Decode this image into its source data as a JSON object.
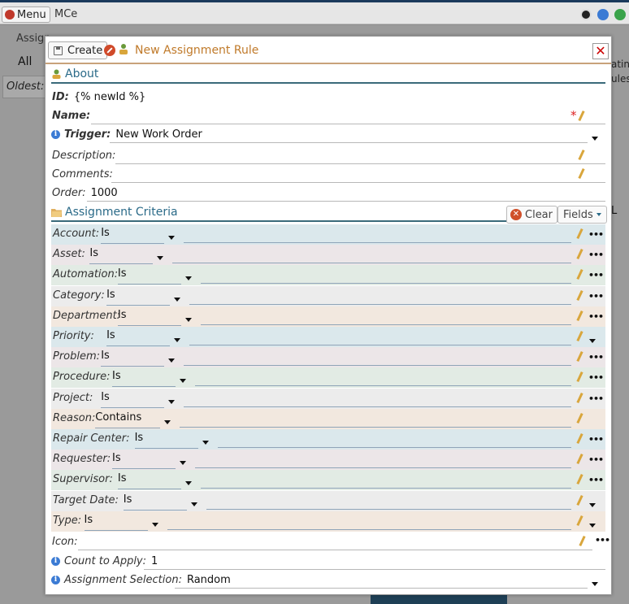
{
  "app": {
    "menu_label": "Menu",
    "title": "MCe"
  },
  "background": {
    "tab_label": "Assign",
    "filter_all": "All",
    "oldest_label": "Oldest:",
    "right_text_1": "ating",
    "right_text_2": "ules",
    "right_letter": "L"
  },
  "dialog": {
    "create_label": "Create",
    "title": "New Assignment Rule",
    "close_label": "✕",
    "about": {
      "heading": "About",
      "id_label": "ID:",
      "id_value": "{% newId %}",
      "name_label": "Name:",
      "name_value": "",
      "required_mark": "*",
      "trigger_label": "Trigger:",
      "trigger_value": "New Work Order",
      "description_label": "Description:",
      "comments_label": "Comments:",
      "order_label": "Order:",
      "order_value": "1000"
    },
    "criteria": {
      "heading": "Assignment Criteria",
      "clear_label": "Clear",
      "fields_label": "Fields",
      "rows": [
        {
          "label": "Account:",
          "operator": "Is",
          "bg": "#dbe8ec"
        },
        {
          "label": "Asset:",
          "operator": "Is",
          "bg": "#ece6e8"
        },
        {
          "label": "Automation:",
          "operator": "Is",
          "bg": "#e2ebe4"
        },
        {
          "label": "Category:",
          "operator": "Is",
          "bg": "#ececec"
        },
        {
          "label": "Department:",
          "operator": "Is",
          "bg": "#f2e8df"
        },
        {
          "label": "Priority:",
          "operator": "Is",
          "bg": "#dbe8ec"
        },
        {
          "label": "Problem:",
          "operator": "Is",
          "bg": "#ece6e8"
        },
        {
          "label": "Procedure:",
          "operator": "Is",
          "bg": "#e2ebe4"
        },
        {
          "label": "Project:",
          "operator": "Is",
          "bg": "#ececec"
        },
        {
          "label": "Reason:",
          "operator": "Contains",
          "bg": "#f2e8df"
        },
        {
          "label": "Repair Center:",
          "operator": "Is",
          "bg": "#dbe8ec"
        },
        {
          "label": "Requester:",
          "operator": "Is",
          "bg": "#ece6e8"
        },
        {
          "label": "Supervisor:",
          "operator": "Is",
          "bg": "#e2ebe4"
        },
        {
          "label": "Target Date:",
          "operator": "Is",
          "bg": "#ececec"
        },
        {
          "label": "Type:",
          "operator": "Is",
          "bg": "#f2e8df"
        }
      ]
    },
    "bottom": {
      "icon_label": "Icon:",
      "count_label": "Count to Apply:",
      "count_value": "1",
      "selection_label": "Assignment Selection:",
      "selection_value": "Random"
    }
  }
}
